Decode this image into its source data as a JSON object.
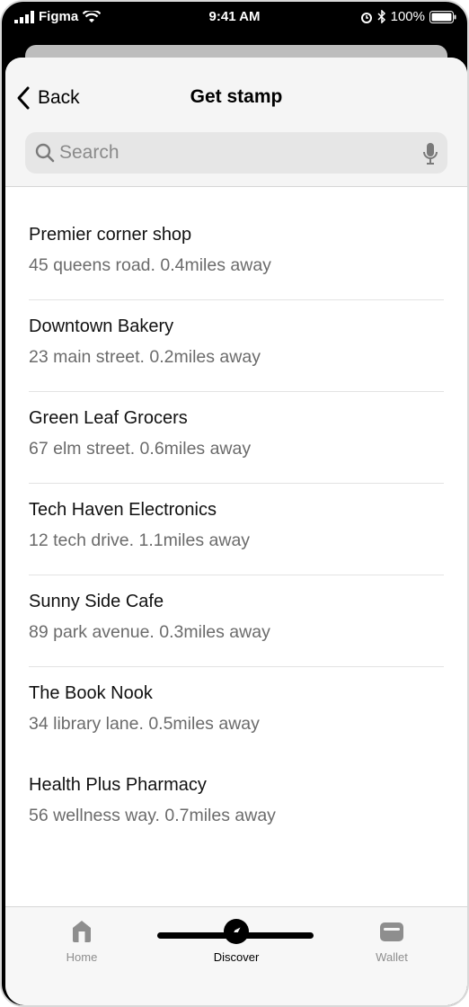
{
  "status_bar": {
    "carrier": "Figma",
    "time": "9:41 AM",
    "battery": "100%"
  },
  "header": {
    "back_label": "Back",
    "title": "Get stamp"
  },
  "search": {
    "placeholder": "Search",
    "value": ""
  },
  "shops": [
    {
      "name": "Premier corner shop",
      "detail": "45 queens road. 0.4miles away"
    },
    {
      "name": "Downtown Bakery",
      "detail": "23 main street. 0.2miles away"
    },
    {
      "name": "Green Leaf Grocers",
      "detail": "67 elm street. 0.6miles away"
    },
    {
      "name": "Tech Haven Electronics",
      "detail": "12 tech drive. 1.1miles away"
    },
    {
      "name": "Sunny Side Cafe",
      "detail": "89 park avenue. 0.3miles away"
    },
    {
      "name": "The Book Nook",
      "detail": "34 library lane. 0.5miles away"
    },
    {
      "name": "Health Plus Pharmacy",
      "detail": "56 wellness way. 0.7miles away"
    }
  ],
  "tabs": [
    {
      "label": "Home",
      "icon": "home-icon",
      "active": false
    },
    {
      "label": "Discover",
      "icon": "compass-icon",
      "active": true
    },
    {
      "label": "Wallet",
      "icon": "wallet-icon",
      "active": false
    }
  ],
  "colors": {
    "active_tab": "#000000",
    "inactive_tab": "#8e8e8e",
    "secondary_text": "#6b6b6b"
  }
}
